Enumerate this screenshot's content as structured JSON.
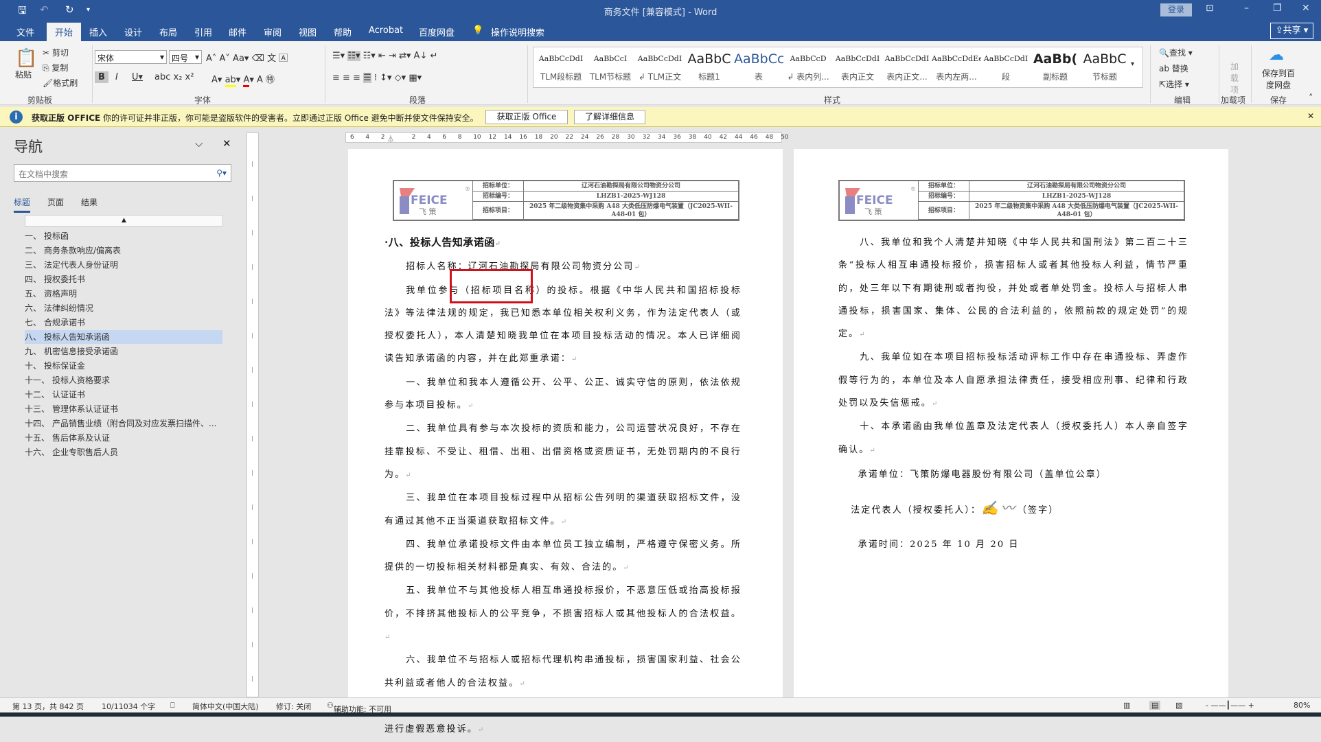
{
  "window": {
    "title": "商务文件 [兼容模式]  -  Word",
    "login": "登录",
    "share": "共享",
    "icons": [
      "save-icon",
      "undo-icon",
      "redo-icon",
      "customize-icon",
      "ribbon-display-icon",
      "minimize-icon",
      "restore-icon",
      "close-icon"
    ]
  },
  "tabs": [
    "文件",
    "开始",
    "插入",
    "设计",
    "布局",
    "引用",
    "邮件",
    "审阅",
    "视图",
    "帮助",
    "Acrobat",
    "百度网盘",
    "操作说明搜索"
  ],
  "ribbon": {
    "clipboard": {
      "label": "剪贴板",
      "paste": "粘贴",
      "cut": "剪切",
      "copy": "复制",
      "format_painter": "格式刷"
    },
    "font": {
      "label": "字体",
      "font_name": "宋体",
      "font_size": "四号"
    },
    "paragraph": {
      "label": "段落"
    },
    "styles": {
      "label": "样式",
      "items": [
        {
          "preview": "AaBbCcDdI",
          "name": "TLM段标题"
        },
        {
          "preview": "AaBbCcI",
          "name": "TLM节标题"
        },
        {
          "preview": "AaBbCcDdI",
          "name": "↲ TLM正文"
        },
        {
          "preview": "AaBbC",
          "name": "标题1"
        },
        {
          "preview": "AaBbCc",
          "name": "表"
        },
        {
          "preview": "AaBbCcD",
          "name": "↲ 表内列..."
        },
        {
          "preview": "AaBbCcDdI",
          "name": "表内正文"
        },
        {
          "preview": "AaBbCcDdI",
          "name": "表内正文..."
        },
        {
          "preview": "AaBbCcDdEe",
          "name": "表内左两..."
        },
        {
          "preview": "AaBbCcDdI",
          "name": "段"
        },
        {
          "preview": "AaBb(",
          "name": "副标题"
        },
        {
          "preview": "AaBbC",
          "name": "节标题"
        }
      ]
    },
    "editing": {
      "label": "编辑",
      "find": "查找",
      "replace": "替换",
      "select": "选择"
    },
    "addins": {
      "label": "加载项",
      "button": "加载项"
    },
    "save": {
      "label": "保存",
      "button": "保存到百度网盘"
    }
  },
  "warning": {
    "title": "获取正版 OFFICE",
    "message": "你的许可证并非正版，你可能是盗版软件的受害者。立即通过正版 Office 避免中断并使文件保持安全。",
    "btn_get": "获取正版 Office",
    "btn_more": "了解详细信息"
  },
  "nav": {
    "title": "导航",
    "search_placeholder": "在文档中搜索",
    "tabs": [
      "标题",
      "页面",
      "结果"
    ],
    "items": [
      {
        "num": "一、",
        "text": "投标函",
        "expand": false
      },
      {
        "num": "二、",
        "text": "商务条款响应/偏离表",
        "expand": false
      },
      {
        "num": "三、",
        "text": "法定代表人身份证明",
        "expand": false
      },
      {
        "num": "四、",
        "text": "授权委托书",
        "expand": false
      },
      {
        "num": "五、",
        "text": "资格声明",
        "expand": false
      },
      {
        "num": "六、",
        "text": "法律纠纷情况",
        "expand": false
      },
      {
        "num": "七、",
        "text": "合规承诺书",
        "expand": false
      },
      {
        "num": "八、",
        "text": "投标人告知承诺函",
        "expand": false,
        "selected": true
      },
      {
        "num": "九、",
        "text": "机密信息接受承诺函",
        "expand": false
      },
      {
        "num": "十、",
        "text": "投标保证金",
        "expand": false
      },
      {
        "num": "十一、",
        "text": "投标人资格要求",
        "expand": true
      },
      {
        "num": "十二、",
        "text": "认证证书",
        "expand": true
      },
      {
        "num": "十三、",
        "text": "管理体系认证证书",
        "expand": true
      },
      {
        "num": "十四、",
        "text": "产品销售业绩（附合同及对应发票扫描件、...",
        "expand": true
      },
      {
        "num": "十五、",
        "text": "售后体系及认证",
        "expand": true
      },
      {
        "num": "十六、",
        "text": "企业专职售后人员",
        "expand": true
      }
    ]
  },
  "ruler": [
    "6",
    "4",
    "2",
    "",
    "2",
    "4",
    "6",
    "8",
    "10",
    "12",
    "14",
    "16",
    "18",
    "20",
    "22",
    "24",
    "26",
    "28",
    "30",
    "32",
    "34",
    "36",
    "38",
    "40",
    "42",
    "44",
    "46",
    "48",
    "50"
  ],
  "header_table": {
    "logo_text": "FEICE",
    "logo_cn": "飞 策",
    "rows": [
      {
        "label": "招标单位：",
        "value": "辽河石油勘探局有限公司物资分公司"
      },
      {
        "label": "招标编号：",
        "value": "LHZB1-2025-WJ128"
      },
      {
        "label": "招标项目：",
        "value": "2025 年二级物资集中采购 A48 大类低压防爆电气装置（JC2025-WII-A48-01 包）"
      }
    ]
  },
  "page1": {
    "heading": "八、投标人告知承诺函",
    "paragraphs": [
      "招标人名称：辽河石油勘探局有限公司物资分公司",
      "我单位参与（招标项目名称）的投标。根据《中华人民共和国招标投标法》等法律法规的规定，我已知悉本单位相关权利义务，作为法定代表人（或授权委托人），本人清楚知晓我单位在本项目投标活动的情况。本人已详细阅读告知承诺函的内容，并在此郑重承诺：",
      "一、我单位和我本人遵循公开、公平、公正、诚实守信的原则，依法依规参与本项目投标。",
      "二、我单位具有参与本次投标的资质和能力，公司运营状况良好，不存在挂靠投标、不受让、租借、出租、出借资格或资质证书，无处罚期内的不良行为。",
      "三、我单位在本项目投标过程中从招标公告列明的渠道获取招标文件，没有通过其他不正当渠道获取招标文件。",
      "四、我单位承诺投标文件由本单位员工独立编制，严格遵守保密义务。所提供的一切投标相关材料都是真实、有效、合法的。",
      "五、我单位不与其他投标人相互串通投标报价，不恶意压低或抬高投标报价，不排挤其他投标人的公平竞争，不损害招标人或其他投标人的合法权益。",
      "六、我单位不与招标人或招标代理机构串通投标，损害国家利益、社会公共利益或者他人的合法权益。",
      "七、我单位不向招标人或者评标委员会成员行贿以牟取中标，不在开标后进行虚假恶意投诉。"
    ],
    "highlight_color": "#d0101b"
  },
  "page2": {
    "paragraphs": [
      "八、我单位和我个人清楚并知晓《中华人民共和国刑法》第二百二十三条“投标人相互串通投标报价，损害招标人或者其他投标人利益，情节严重的，处三年以下有期徒刑或者拘役，并处或者单处罚金。投标人与招标人串通投标，损害国家、集体、公民的合法利益的，依照前款的规定处罚”的规定。",
      "九、我单位如在本项目招标投标活动评标工作中存在串通投标、弄虚作假等行为的，本单位及本人自愿承担法律责任，接受相应刑事、纪律和行政处罚以及失信惩戒。",
      "十、本承诺函由我单位盖章及法定代表人（授权委托人）本人亲自签字确认。"
    ],
    "unit": "承诺单位：飞策防爆电器股份有限公司（盖单位公章）",
    "rep_label": "法定代表人（授权委托人）：",
    "signature": "南君村",
    "sign_suffix": "（签字）",
    "date": "承诺时间：2025 年 10 月 20 日"
  },
  "status": {
    "page": "第 13 页，共 842 页",
    "words": "10/11034 个字",
    "lang": "简体中文(中国大陆)",
    "track": "修订: 关闭",
    "access": "辅助功能: 不可用",
    "zoom": "80%",
    "zoom_level": 80
  }
}
